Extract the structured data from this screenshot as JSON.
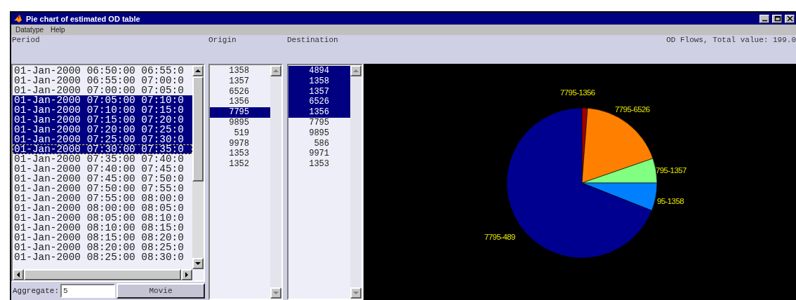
{
  "window": {
    "title": "Pie chart of estimated OD table"
  },
  "menu": [
    {
      "label": "Datatype"
    },
    {
      "label": "Help"
    }
  ],
  "headers": {
    "period": "Period",
    "origin": "Origin",
    "destination": "Destination",
    "total": "OD Flows, Total value: 199.0"
  },
  "periods": [
    {
      "text": "01-Jan-2000 06:50:00 06:55:0",
      "selected": false
    },
    {
      "text": "01-Jan-2000 06:55:00 07:00:0",
      "selected": false
    },
    {
      "text": "01-Jan-2000 07:00:00 07:05:0",
      "selected": false
    },
    {
      "text": "01-Jan-2000 07:05:00 07:10:0",
      "selected": true
    },
    {
      "text": "01-Jan-2000 07:10:00 07:15:0",
      "selected": true
    },
    {
      "text": "01-Jan-2000 07:15:00 07:20:0",
      "selected": true
    },
    {
      "text": "01-Jan-2000 07:20:00 07:25:0",
      "selected": true
    },
    {
      "text": "01-Jan-2000 07:25:00 07:30:0",
      "selected": true
    },
    {
      "text": "01-Jan-2000 07:30:00 07:35:0",
      "selected": true
    },
    {
      "text": "01-Jan-2000 07:35:00 07:40:0",
      "selected": false
    },
    {
      "text": "01-Jan-2000 07:40:00 07:45:0",
      "selected": false
    },
    {
      "text": "01-Jan-2000 07:45:00 07:50:0",
      "selected": false
    },
    {
      "text": "01-Jan-2000 07:50:00 07:55:0",
      "selected": false
    },
    {
      "text": "01-Jan-2000 07:55:00 08:00:0",
      "selected": false
    },
    {
      "text": "01-Jan-2000 08:00:00 08:05:0",
      "selected": false
    },
    {
      "text": "01-Jan-2000 08:05:00 08:10:0",
      "selected": false
    },
    {
      "text": "01-Jan-2000 08:10:00 08:15:0",
      "selected": false
    },
    {
      "text": "01-Jan-2000 08:15:00 08:20:0",
      "selected": false
    },
    {
      "text": "01-Jan-2000 08:20:00 08:25:0",
      "selected": false
    },
    {
      "text": "01-Jan-2000 08:25:00 08:30:0",
      "selected": false
    }
  ],
  "origins": [
    {
      "text": "1358",
      "selected": false
    },
    {
      "text": "1357",
      "selected": false
    },
    {
      "text": "6526",
      "selected": false
    },
    {
      "text": "1356",
      "selected": false
    },
    {
      "text": "7795",
      "selected": true
    },
    {
      "text": "9895",
      "selected": false
    },
    {
      "text": "519",
      "selected": false
    },
    {
      "text": "9978",
      "selected": false
    },
    {
      "text": "1353",
      "selected": false
    },
    {
      "text": "1352",
      "selected": false
    }
  ],
  "destinations": [
    {
      "text": "4894",
      "selected": true
    },
    {
      "text": "1358",
      "selected": true
    },
    {
      "text": "1357",
      "selected": true
    },
    {
      "text": "6526",
      "selected": true
    },
    {
      "text": "1356",
      "selected": true
    },
    {
      "text": "7795",
      "selected": false
    },
    {
      "text": "9895",
      "selected": false
    },
    {
      "text": "586",
      "selected": false
    },
    {
      "text": "9971",
      "selected": false
    },
    {
      "text": "1353",
      "selected": false
    }
  ],
  "aggregate": {
    "label": "Aggregate:",
    "value": "5"
  },
  "movie_button": {
    "label": "Movie"
  },
  "pie": {
    "slices": [
      {
        "label": "7795-1356",
        "color": "#a00000"
      },
      {
        "label": "7795-6526",
        "color": "#ff8000"
      },
      {
        "label": "795-1357",
        "color": "#80ff80"
      },
      {
        "label": "95-1358",
        "color": "#0080ff"
      },
      {
        "label": "7795-489",
        "color": "#000090"
      }
    ]
  }
}
